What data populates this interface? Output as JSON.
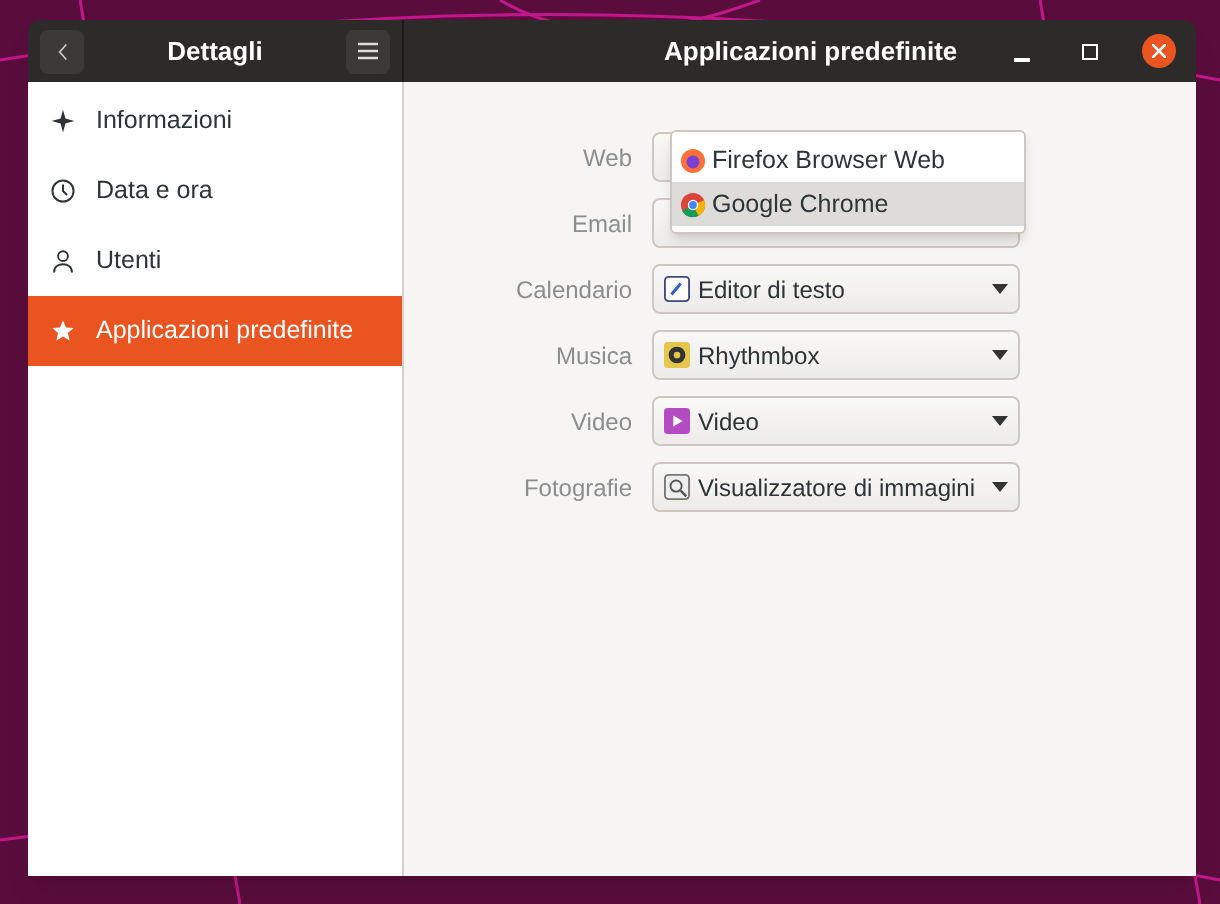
{
  "header": {
    "left_title": "Dettagli",
    "title": "Applicazioni predefinite"
  },
  "sidebar": {
    "items": [
      {
        "label": "Informazioni",
        "selected": false
      },
      {
        "label": "Data e ora",
        "selected": false
      },
      {
        "label": "Utenti",
        "selected": false
      },
      {
        "label": "Applicazioni predefinite",
        "selected": true
      }
    ]
  },
  "settings": [
    {
      "label": "Web"
    },
    {
      "label": "Email"
    },
    {
      "label": "Calendario",
      "value": "Editor di testo"
    },
    {
      "label": "Musica",
      "value": "Rhythmbox"
    },
    {
      "label": "Video",
      "value": "Video"
    },
    {
      "label": "Fotografie",
      "value": "Visualizzatore di immagini"
    }
  ],
  "web_menu": {
    "items": [
      {
        "label": "Firefox Browser Web",
        "selected": false
      },
      {
        "label": "Google Chrome",
        "selected": true
      }
    ]
  }
}
